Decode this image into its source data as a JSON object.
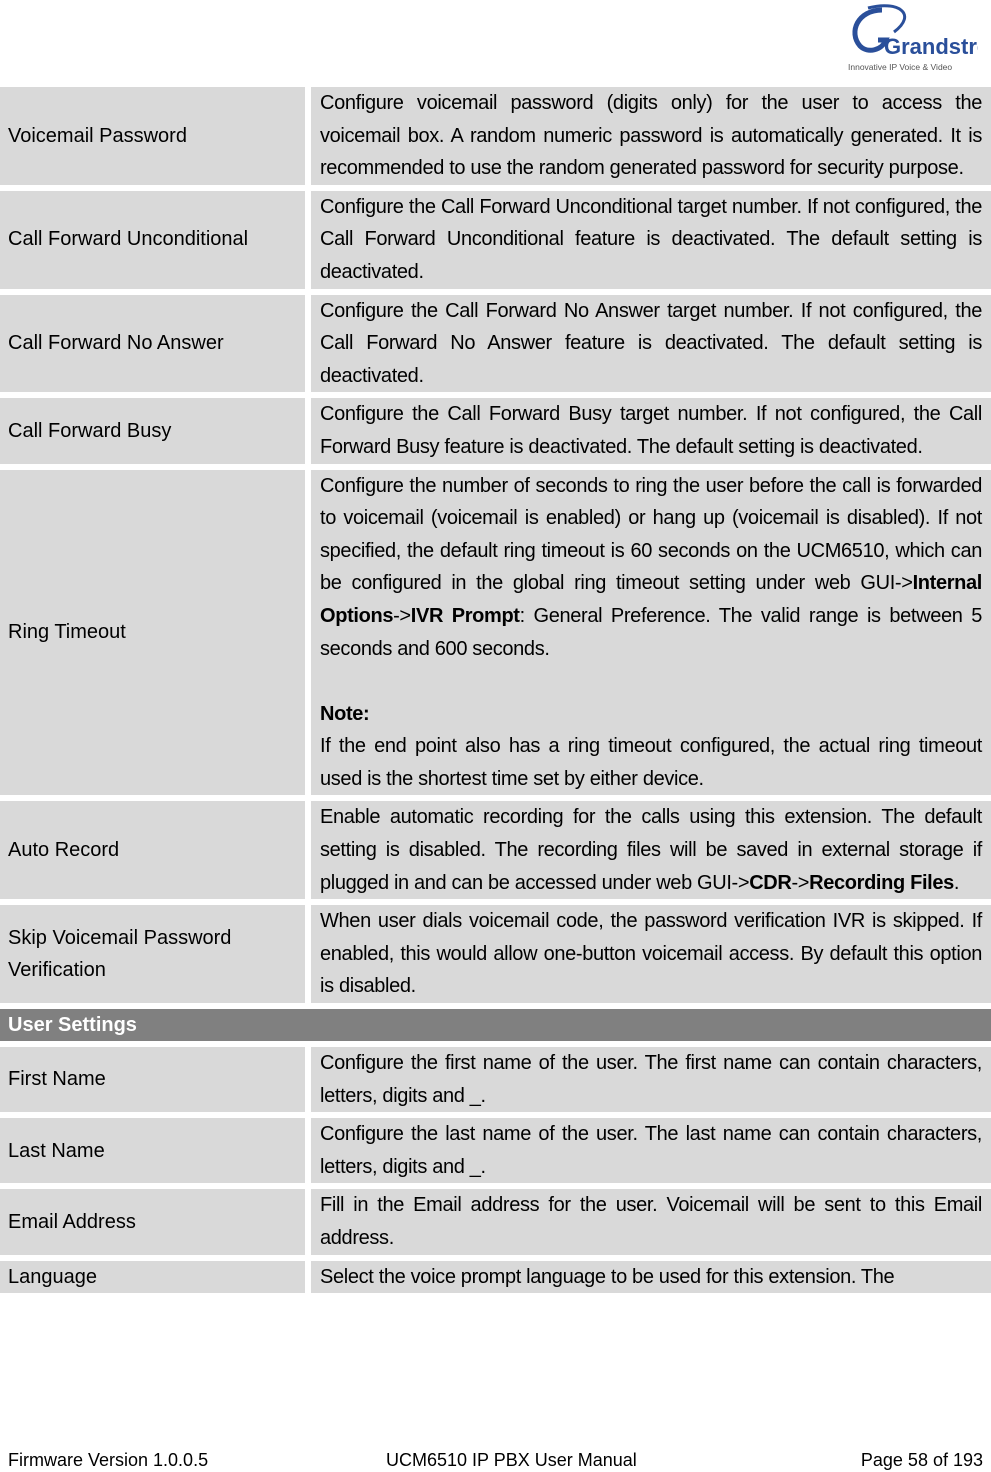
{
  "header": {
    "logo": {
      "brand": "Grandstream",
      "tagline": "Innovative IP Voice & Video",
      "icon": "grandstream-logo-icon"
    }
  },
  "rows": [
    {
      "name": "Voicemail Password",
      "desc": [
        {
          "t": "Configure voicemail password (digits only) for the user to access the voicemail box. A random numeric password is automatically generated. It is recommended to use the random generated password for security purpose.",
          "b": false
        }
      ]
    },
    {
      "name": "Call Forward Unconditional",
      "desc": [
        {
          "t": "Configure the Call Forward Unconditional target number. If not configured, the Call Forward Unconditional feature is deactivated. The default setting is deactivated.",
          "b": false
        }
      ]
    },
    {
      "name": "Call Forward No Answer",
      "desc": [
        {
          "t": "Configure the Call Forward No Answer target number. If not configured, the Call Forward No Answer feature is deactivated. The default setting is deactivated.",
          "b": false
        }
      ]
    },
    {
      "name": "Call Forward Busy",
      "desc": [
        {
          "t": "Configure the Call Forward Busy target number. If not configured, the Call Forward Busy feature is deactivated. The default setting is deactivated.",
          "b": false
        }
      ]
    },
    {
      "name": "Ring Timeout",
      "desc": [
        {
          "t": "Configure the number of seconds to ring the user before the call is forwarded to voicemail (voicemail is enabled) or hang up (voicemail is disabled). If not specified, the default ring timeout is 60 seconds on the UCM6510, which can be configured in the global ring timeout setting under web GUI->",
          "b": false
        },
        {
          "t": "Internal Options",
          "b": true
        },
        {
          "t": "->",
          "b": false
        },
        {
          "t": "IVR Prompt",
          "b": true
        },
        {
          "t": ": General Preference. The valid range is between 5 seconds and 600 seconds.",
          "b": false
        }
      ],
      "note_label": "Note:",
      "note": "If the end point also has a ring timeout configured, the actual ring timeout used is the shortest time set by either device."
    },
    {
      "name": "Auto Record",
      "desc": [
        {
          "t": "Enable automatic recording for the calls using this extension. The default setting is disabled. The recording files will be saved in external storage if plugged in and can be accessed under web GUI->",
          "b": false
        },
        {
          "t": "CDR",
          "b": true
        },
        {
          "t": "->",
          "b": false
        },
        {
          "t": "Recording Files",
          "b": true
        },
        {
          "t": ".",
          "b": false
        }
      ]
    },
    {
      "name": "Skip Voicemail Password Verification",
      "desc": [
        {
          "t": "When user dials voicemail code, the password verification IVR is skipped. If enabled, this would allow one-button voicemail access. By default this option is disabled.",
          "b": false
        }
      ]
    }
  ],
  "section": {
    "title": "User Settings",
    "color": "#808080"
  },
  "user_rows": [
    {
      "name": "First Name",
      "desc": [
        {
          "t": "Configure the first name of the user. The first name can contain characters, letters, digits and _.",
          "b": false
        }
      ]
    },
    {
      "name": "Last Name",
      "desc": [
        {
          "t": "Configure the last name of the user. The last name can contain characters, letters, digits and _.",
          "b": false
        }
      ]
    },
    {
      "name": "Email Address",
      "desc": [
        {
          "t": "Fill in the Email address for the user. Voicemail will be sent to this Email address.",
          "b": false
        }
      ]
    },
    {
      "name": "Language",
      "desc": [
        {
          "t": "Select the voice prompt language to be used for this extension. The",
          "b": false
        }
      ]
    }
  ],
  "colors": {
    "cell_bg": "#d9d9d9",
    "section_bg": "#808080",
    "section_text": "#ffffff"
  },
  "footer": {
    "firmware": "Firmware Version 1.0.0.5",
    "manual": "UCM6510 IP PBX User Manual",
    "page": "Page 58 of 193"
  }
}
